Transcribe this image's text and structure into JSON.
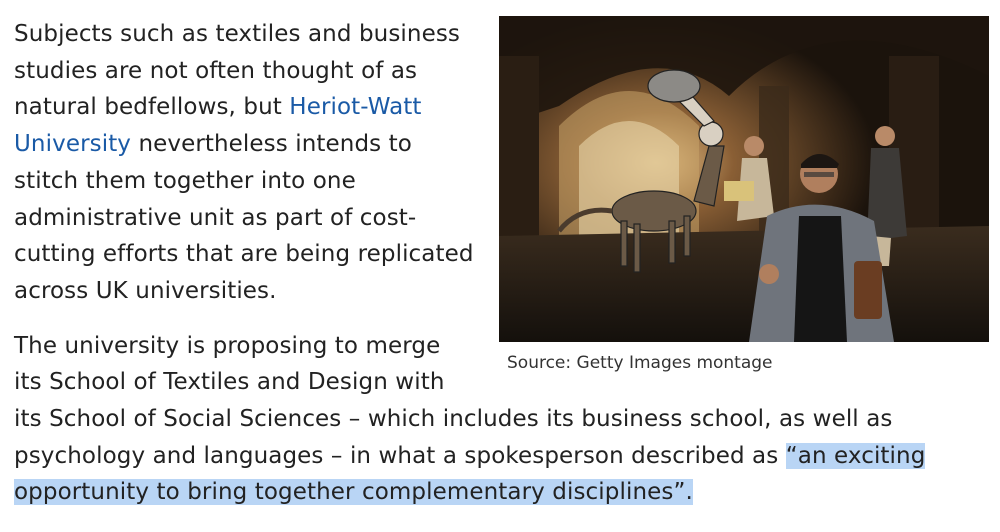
{
  "figure": {
    "image_alt": "Centaur and people fleeing through a stone archway",
    "caption": "Source: Getty Images montage"
  },
  "paragraphs": {
    "p1_before_link": "Subjects such as textiles and business studies are not often thought of as natural bedfellows, but ",
    "p1_link": "Heriot-Watt University",
    "p1_after_link": " nevertheless intends to stitch them together into one administrative unit as part of cost-cutting efforts that are being replicated across UK universities.",
    "p2_before_quote": "The university is proposing to merge its School of Textiles and Design with its School of Social Sciences – which includes its business school, as well as psychology and languages – in what a spokesperson described as ",
    "p2_quote": "“an exciting opportunity to bring together complementary disciplines”."
  },
  "colors": {
    "link": "#1a5aa6",
    "selection_highlight": "#b9d5f5"
  }
}
